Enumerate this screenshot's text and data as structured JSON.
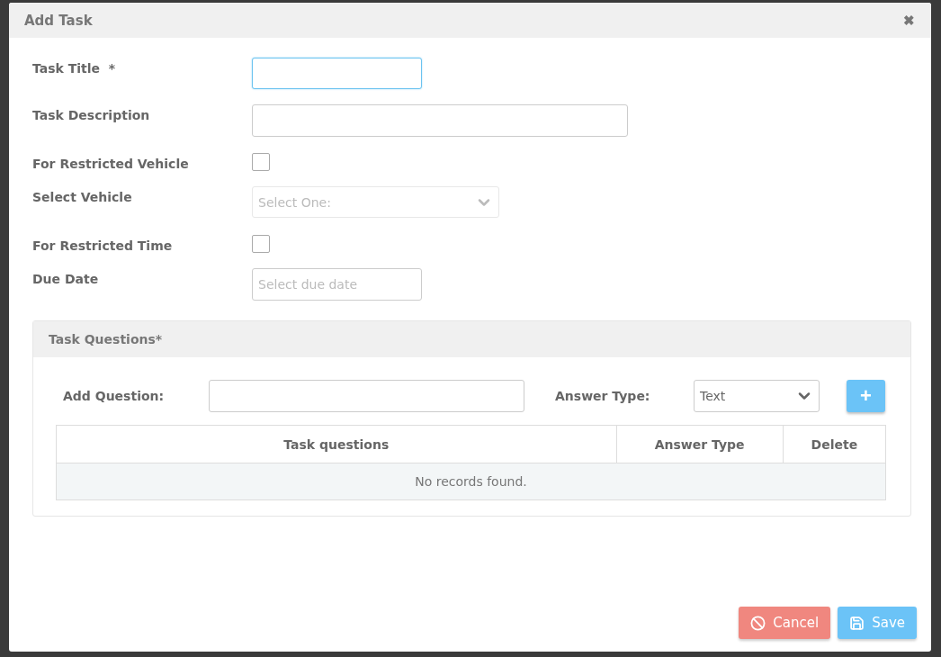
{
  "dialog": {
    "title": "Add Task",
    "close_label": "✖"
  },
  "fields": [
    {
      "kind": "text",
      "label": "Task Title  *",
      "focused": true
    },
    {
      "kind": "textarea",
      "label": "Task Description",
      "focused": false
    },
    {
      "kind": "checkbox",
      "label": "For Restricted Vehicle",
      "checked": false
    },
    {
      "kind": "select",
      "label": "Select Vehicle",
      "placeholder": "Select One:",
      "disabled": true
    },
    {
      "kind": "checkbox",
      "label": "For Restricted Time",
      "checked": false
    },
    {
      "kind": "date",
      "label": "Due Date",
      "placeholder": "Select due date"
    }
  ],
  "questions_panel": {
    "title": "Task Questions*",
    "add_question_label": "Add Question:",
    "answer_type_label": "Answer Type:",
    "answer_type_value": "Text",
    "add_button": "+",
    "table": {
      "columns": [
        "Task questions",
        "Answer Type",
        "Delete"
      ],
      "empty_message": "No records found."
    }
  },
  "buttons": [
    {
      "kind": "cancel",
      "label": "Cancel"
    },
    {
      "kind": "save",
      "label": "Save"
    }
  ]
}
